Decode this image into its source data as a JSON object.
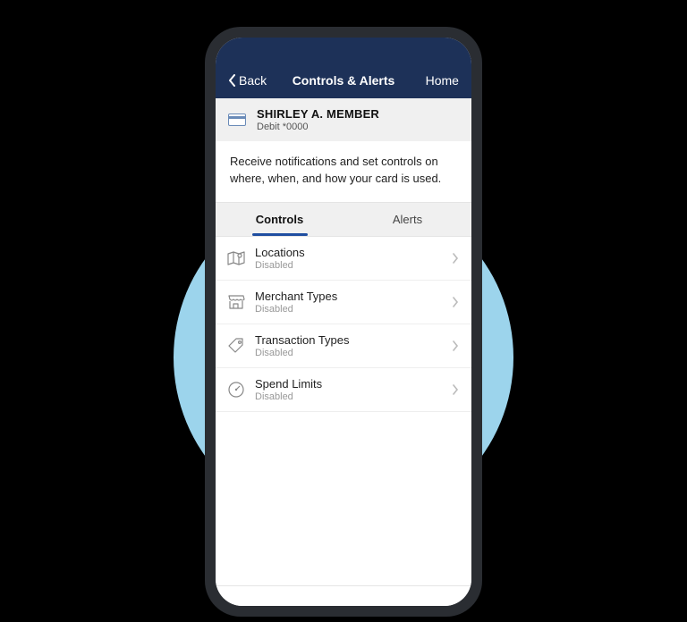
{
  "nav": {
    "back": "Back",
    "title": "Controls & Alerts",
    "home": "Home"
  },
  "card": {
    "name": "SHIRLEY A. MEMBER",
    "sub": "Debit *0000"
  },
  "description": "Receive notifications and set controls on where, when, and how your card is used.",
  "tabs": {
    "controls": "Controls",
    "alerts": "Alerts"
  },
  "items": [
    {
      "title": "Locations",
      "sub": "Disabled"
    },
    {
      "title": "Merchant Types",
      "sub": "Disabled"
    },
    {
      "title": "Transaction Types",
      "sub": "Disabled"
    },
    {
      "title": "Spend Limits",
      "sub": "Disabled"
    }
  ]
}
